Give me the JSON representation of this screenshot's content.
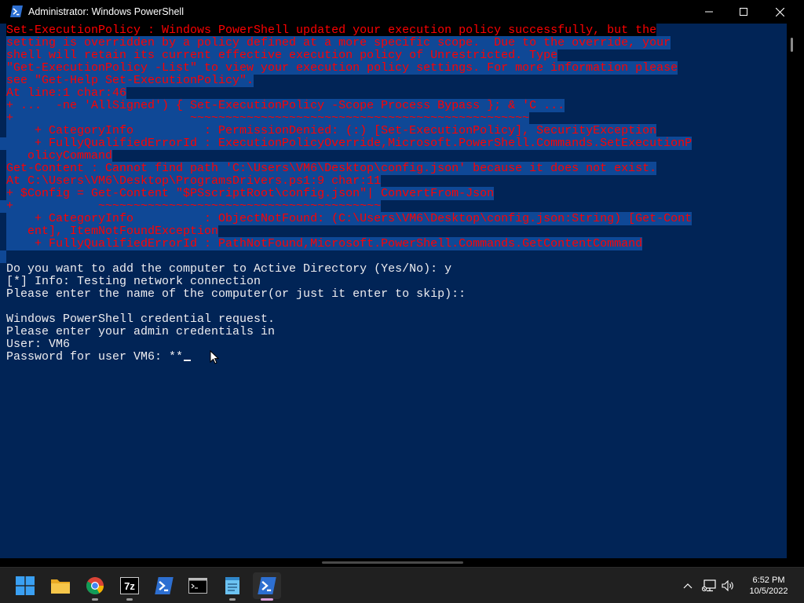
{
  "window": {
    "title": "Administrator: Windows PowerShell",
    "controls": {
      "minimize": "minimize",
      "maximize": "maximize",
      "close": "close"
    }
  },
  "console": {
    "colors": {
      "background": "#012456",
      "foreground": "#eeedf0",
      "error_fg": "#ff0000",
      "error_bg": "#000000",
      "selection_bg": "#0f4896"
    },
    "lines": [
      "Set-ExecutionPolicy : Windows PowerShell updated your execution policy successfully, but the",
      "setting is overridden by a policy defined at a more specific scope.  Due to the override, your",
      "shell will retain its current effective execution policy of Unrestricted. Type",
      "\"Get-ExecutionPolicy -List\" to view your execution policy settings. For more information please",
      "see \"Get-Help Set-ExecutionPolicy\".",
      "At line:1 char:46",
      "+ ...  -ne 'AllSigned') { Set-ExecutionPolicy -Scope Process Bypass }; & 'C ...",
      "+                         ~~~~~~~~~~~~~~~~~~~~~~~~~~~~~~~~~~~~~~~~~~~~~~~~",
      "    + CategoryInfo          : PermissionDenied: (:) [Set-ExecutionPolicy], SecurityException",
      "    + FullyQualifiedErrorId : ExecutionPolicyOverride,Microsoft.PowerShell.Commands.SetExecutionP",
      "   olicyCommand",
      "Get-Content : Cannot find path 'C:\\Users\\VM6\\Desktop\\config.json' because it does not exist.",
      "At C:\\Users\\VM6\\Desktop\\ProgramsDrivers.ps1:9 char:11",
      "+ $Config = Get-Content \"$PSscriptRoot\\config.json\"| ConvertFrom-Json",
      "+            ~~~~~~~~~~~~~~~~~~~~~~~~~~~~~~~~~~~~~~~~",
      "    + CategoryInfo          : ObjectNotFound: (C:\\Users\\VM6\\Desktop\\config.json:String) [Get-Cont",
      "   ent], ItemNotFoundException",
      "    + FullyQualifiedErrorId : PathNotFound,Microsoft.PowerShell.Commands.GetContentCommand",
      "",
      "Do you want to add the computer to Active Directory (Yes/No): y",
      "[*] Info: Testing network connection",
      "Please enter the name of the computer(or just it enter to skip)::",
      "",
      "Windows PowerShell credential request.",
      "Please enter your admin credentials in",
      "User: VM6",
      "Password for user VM6: **"
    ]
  },
  "taskbar": {
    "items": [
      {
        "name": "start",
        "icon": "windows-start-icon"
      },
      {
        "name": "file-explorer",
        "icon": "folder-icon"
      },
      {
        "name": "chrome",
        "icon": "chrome-icon"
      },
      {
        "name": "7zip",
        "icon": "7zip-icon",
        "label": "7z"
      },
      {
        "name": "powershell",
        "icon": "powershell-icon"
      },
      {
        "name": "command-prompt",
        "icon": "terminal-icon"
      },
      {
        "name": "notepad",
        "icon": "notepad-icon"
      },
      {
        "name": "powershell-admin",
        "icon": "powershell-icon",
        "active": true
      }
    ],
    "tray": {
      "chevron": "chevron-up-icon",
      "network": "network-icon",
      "volume": "volume-icon"
    },
    "clock": {
      "time": "6:52 PM",
      "date": "10/5/2022"
    }
  }
}
